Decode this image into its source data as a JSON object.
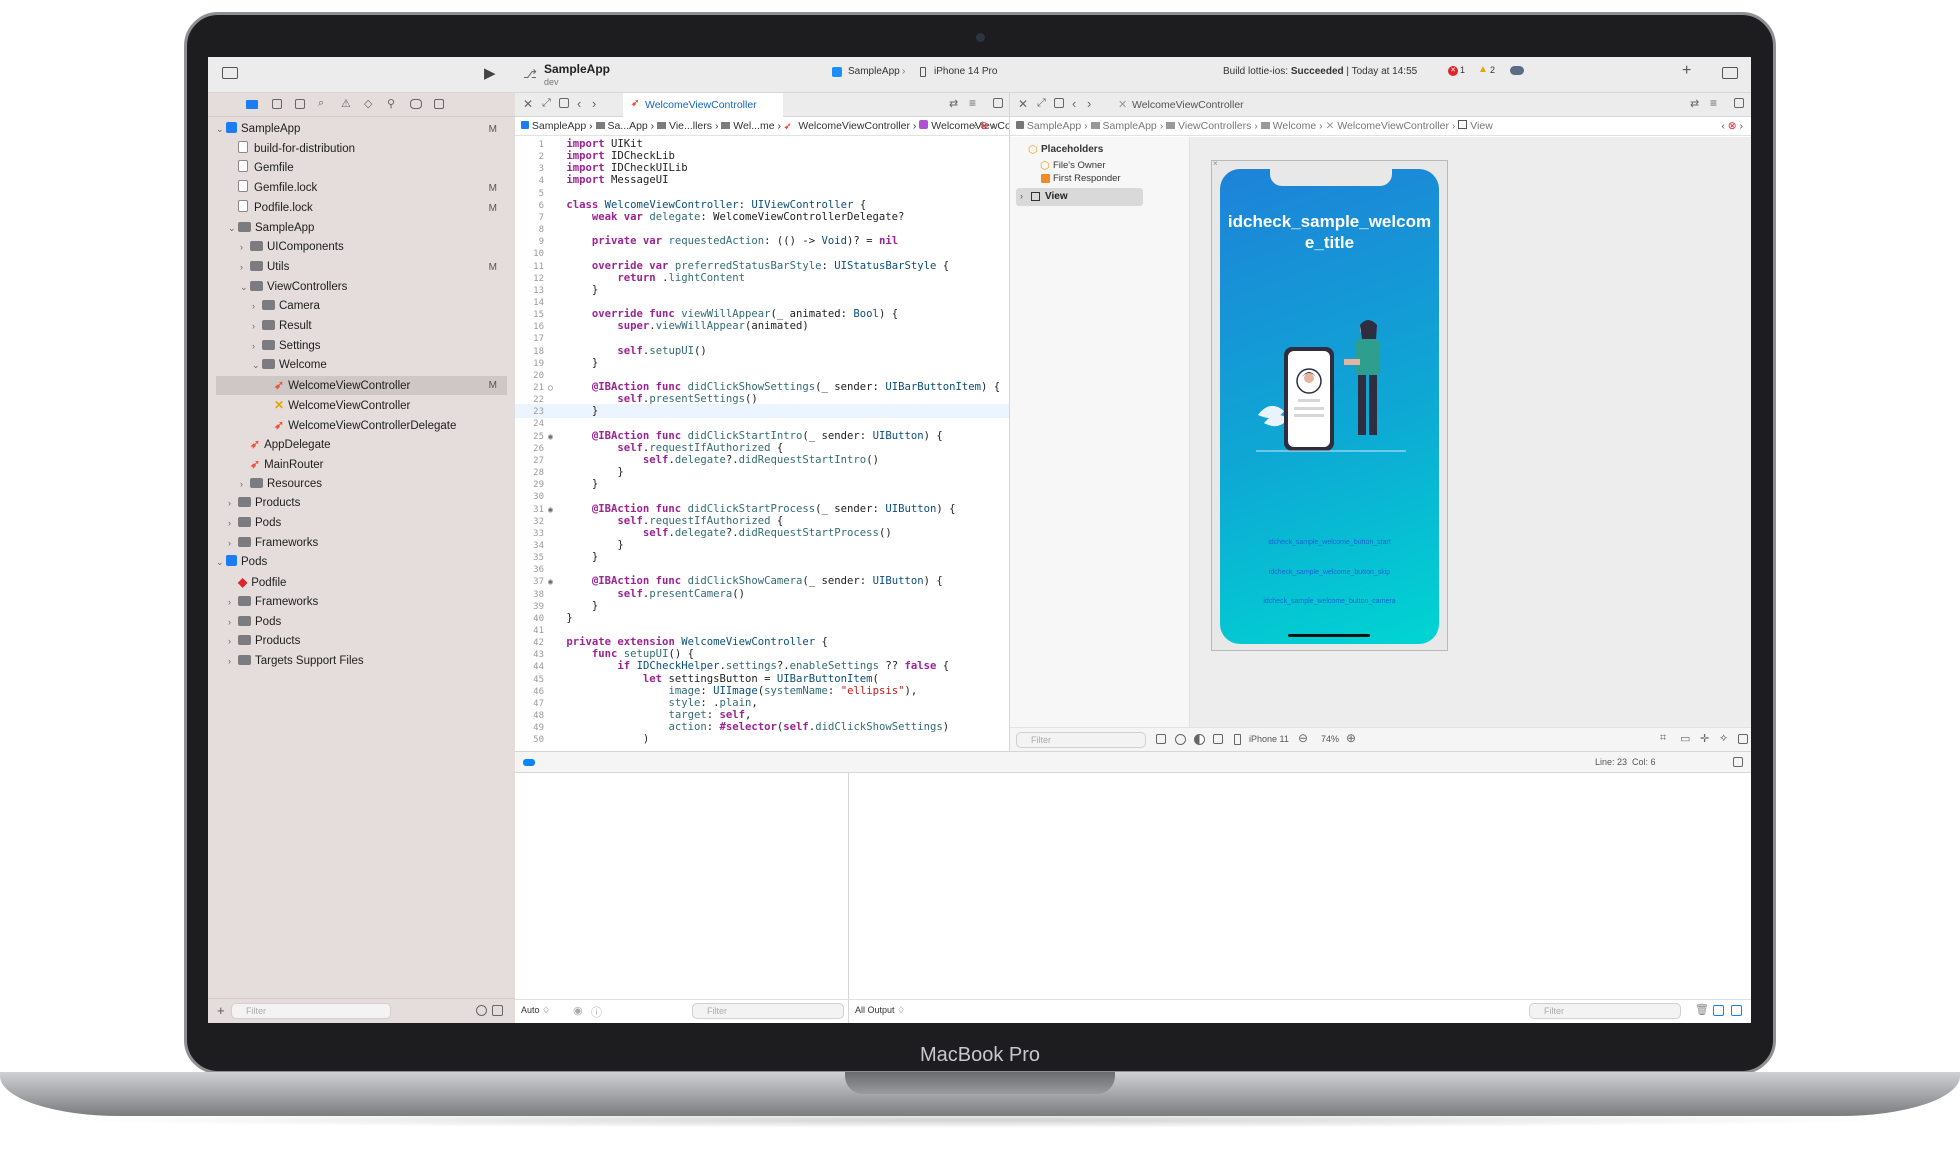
{
  "device": {
    "brand": "MacBook Pro"
  },
  "toolbar": {
    "project": "SampleApp",
    "branch": "dev",
    "scheme": "SampleApp",
    "destination": "iPhone 14 Pro",
    "status_prefix": "Build lottie-ios: ",
    "status_result": "Succeeded",
    "status_time": "| Today at 14:55",
    "errors": "1",
    "warnings": "2",
    "play_icon": "play-icon",
    "add_icon": "plus-icon"
  },
  "navigator": {
    "items": [
      {
        "label": "SampleApp",
        "badge": "M"
      },
      {
        "label": "build-for-distribution",
        "badge": ""
      },
      {
        "label": "Gemfile",
        "badge": ""
      },
      {
        "label": "Gemfile.lock",
        "badge": "M"
      },
      {
        "label": "Podfile.lock",
        "badge": "M"
      },
      {
        "label": "SampleApp",
        "badge": ""
      },
      {
        "label": "UIComponents",
        "badge": ""
      },
      {
        "label": "Utils",
        "badge": "M"
      },
      {
        "label": "ViewControllers",
        "badge": ""
      },
      {
        "label": "Camera",
        "badge": ""
      },
      {
        "label": "Result",
        "badge": ""
      },
      {
        "label": "Settings",
        "badge": ""
      },
      {
        "label": "Welcome",
        "badge": ""
      },
      {
        "label": "WelcomeViewController",
        "badge": "M"
      },
      {
        "label": "WelcomeViewController",
        "badge": ""
      },
      {
        "label": "WelcomeViewControllerDelegate",
        "badge": ""
      },
      {
        "label": "AppDelegate",
        "badge": ""
      },
      {
        "label": "MainRouter",
        "badge": ""
      },
      {
        "label": "Resources",
        "badge": ""
      },
      {
        "label": "Products",
        "badge": ""
      },
      {
        "label": "Pods",
        "badge": ""
      },
      {
        "label": "Frameworks",
        "badge": ""
      },
      {
        "label": "Pods",
        "badge": ""
      },
      {
        "label": "Podfile",
        "badge": ""
      },
      {
        "label": "Frameworks",
        "badge": ""
      },
      {
        "label": "Pods",
        "badge": ""
      },
      {
        "label": "Products",
        "badge": ""
      },
      {
        "label": "Targets Support Files",
        "badge": ""
      }
    ],
    "filter_placeholder": "Filter"
  },
  "editor": {
    "tab": "WelcomeViewController",
    "crumbs": [
      "SampleApp",
      "Sa...App",
      "Vie...llers",
      "Wel...me",
      "WelcomeViewController",
      "WelcomeViewController"
    ],
    "current_line": 23
  },
  "ib": {
    "tab": "WelcomeViewController",
    "crumbs": [
      "SampleApp",
      "SampleApp",
      "ViewControllers",
      "Welcome",
      "WelcomeViewController",
      "View"
    ],
    "outline": {
      "placeholders": "Placeholders",
      "files_owner": "File's Owner",
      "first_responder": "First Responder",
      "view": "View"
    },
    "phone": {
      "title": "idcheck_sample_welcom e_title",
      "button_start": "idcheck_sample_welcome_button_start",
      "button_skip": "idcheck_sample_welcome_button_skip",
      "button_camera": "idcheck_sample_welcome_button_camera"
    },
    "device": "iPhone 11",
    "zoom": "74%",
    "filter_placeholder": "Filter"
  },
  "debug": {
    "line_col": "Line: 23  Col: 6",
    "auto": "Auto ♢",
    "all_output": "All Output ♢",
    "filter_placeholder": "Filter"
  },
  "colors": {
    "accent": "#0a84ff",
    "swift": "#f05138",
    "error": "#e0242a",
    "warning": "#e8a400"
  }
}
